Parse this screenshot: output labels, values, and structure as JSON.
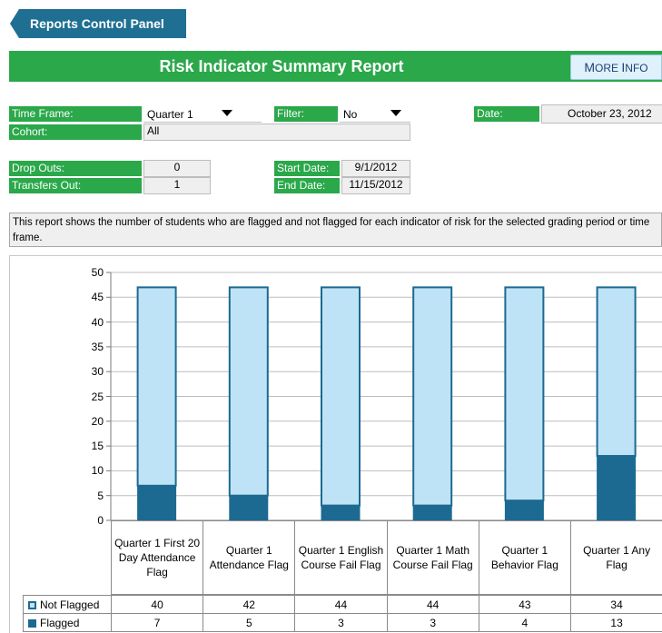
{
  "nav": {
    "back_label": "Reports Control Panel"
  },
  "header": {
    "title": "Risk Indicator Summary Report",
    "more_info_first": "M",
    "more_info_rest": "ORE ",
    "more_info_second": "I",
    "more_info_rest2": "NFO"
  },
  "filters": {
    "time_frame_label": "Time Frame:",
    "time_frame_value": "Quarter 1",
    "filter_label": "Filter:",
    "filter_value": "No",
    "date_label": "Date:",
    "date_value": "October 23, 2012",
    "cohort_label": "Cohort:",
    "cohort_value": "All"
  },
  "stats": {
    "dropouts_label": "Drop Outs:",
    "dropouts_value": "0",
    "transfers_label": "Transfers Out:",
    "transfers_value": "1",
    "start_label": "Start Date:",
    "start_value": "9/1/2012",
    "end_label": "End Date:",
    "end_value": "11/15/2012"
  },
  "description": "This report shows the number of students who are flagged and not flagged for each indicator of risk for the selected grading period or time frame.",
  "colors": {
    "flagged": "#1c6a91",
    "not_flagged": "#bfe3f6",
    "outline": "#1c6a91",
    "green": "#2aa84a"
  },
  "chart_data": {
    "type": "bar",
    "stacked": true,
    "categories": [
      "Quarter 1 First 20 Day Attendance Flag",
      "Quarter 1 Attendance Flag",
      "Quarter 1 English Course Fail Flag",
      "Quarter 1 Math Course Fail Flag",
      "Quarter 1 Behavior Flag",
      "Quarter 1 Any Flag"
    ],
    "series": [
      {
        "name": "Not Flagged",
        "values": [
          40,
          42,
          44,
          44,
          43,
          34
        ]
      },
      {
        "name": "Flagged",
        "values": [
          7,
          5,
          3,
          3,
          4,
          13
        ]
      }
    ],
    "ylim": [
      0,
      50
    ],
    "yticks": [
      "0",
      "5",
      "10",
      "15",
      "20",
      "25",
      "30",
      "35",
      "40",
      "45",
      "50"
    ],
    "grid": true,
    "legend": "data-table"
  }
}
